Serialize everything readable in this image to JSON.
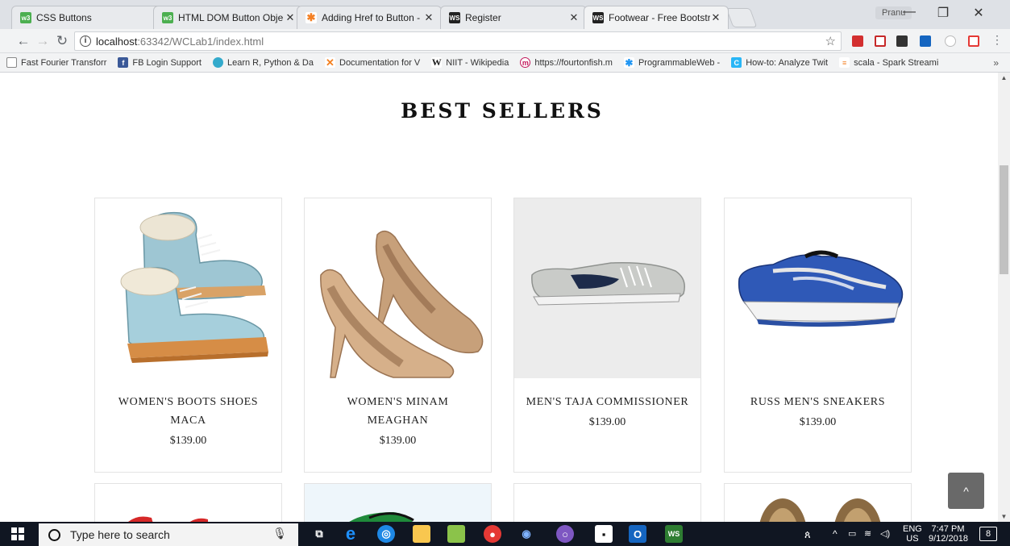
{
  "tabs": [
    {
      "title": "CSS Buttons",
      "favicon": "w3schools-icon",
      "color": "#4caf50",
      "glyph": "w3",
      "active": false
    },
    {
      "title": "HTML DOM Button Obje",
      "favicon": "w3schools-icon",
      "color": "#4caf50",
      "glyph": "w3",
      "active": false
    },
    {
      "title": "Adding Href to Button - ",
      "favicon": "stackoverflow-icon",
      "color": "#f48024",
      "glyph": "✱",
      "active": false
    },
    {
      "title": "Register",
      "favicon": "webstorm-icon",
      "color": "#222",
      "glyph": "WS",
      "active": false
    },
    {
      "title": "Footwear - Free Bootstra",
      "favicon": "webstorm-icon",
      "color": "#222",
      "glyph": "WS",
      "active": true
    }
  ],
  "profile_name": "Pranu",
  "address": {
    "host": "localhost",
    "path": ":63342/WCLab1/index.html"
  },
  "bookmarks": [
    {
      "label": "Fast Fourier Transforr",
      "icon": "page-icon",
      "color": "#ffffff",
      "glyph": ""
    },
    {
      "label": "FB Login Support",
      "icon": "facebook-icon",
      "color": "#3b5998",
      "glyph": "f"
    },
    {
      "label": "Learn R, Python & Da",
      "icon": "datacamp-icon",
      "color": "#3ac",
      "glyph": "◆"
    },
    {
      "label": "Documentation for V",
      "icon": "vscode-icon",
      "color": "#f38020",
      "glyph": "✕"
    },
    {
      "label": "NIIT - Wikipedia",
      "icon": "wikipedia-icon",
      "color": "#ffffff",
      "glyph": "W"
    },
    {
      "label": "https://fourtonfish.m",
      "icon": "fourtonfish-icon",
      "color": "#c2185b",
      "glyph": "m"
    },
    {
      "label": "ProgrammableWeb -",
      "icon": "programmableweb-icon",
      "color": "#2196f3",
      "glyph": "✱"
    },
    {
      "label": "How-to: Analyze Twit",
      "icon": "cloudera-icon",
      "color": "#29b6f6",
      "glyph": "C"
    },
    {
      "label": "scala - Spark Streami",
      "icon": "stackoverflow-icon",
      "color": "#f48024",
      "glyph": "≡"
    }
  ],
  "section_title": "BEST SELLERS",
  "products": [
    {
      "name": "WOMEN'S BOOTS SHOES MACA",
      "price": "$139.00"
    },
    {
      "name": "WOMEN'S MINAM MEAGHAN",
      "price": "$139.00"
    },
    {
      "name": "MEN'S TAJA COMMISSIONER",
      "price": "$139.00"
    },
    {
      "name": "RUSS MEN'S SNEAKERS",
      "price": "$139.00"
    }
  ],
  "taskbar": {
    "search_placeholder": "Type here to search",
    "language": "ENG",
    "region": "US",
    "time": "7:47 PM",
    "date": "9/12/2018",
    "notifications": "8"
  }
}
